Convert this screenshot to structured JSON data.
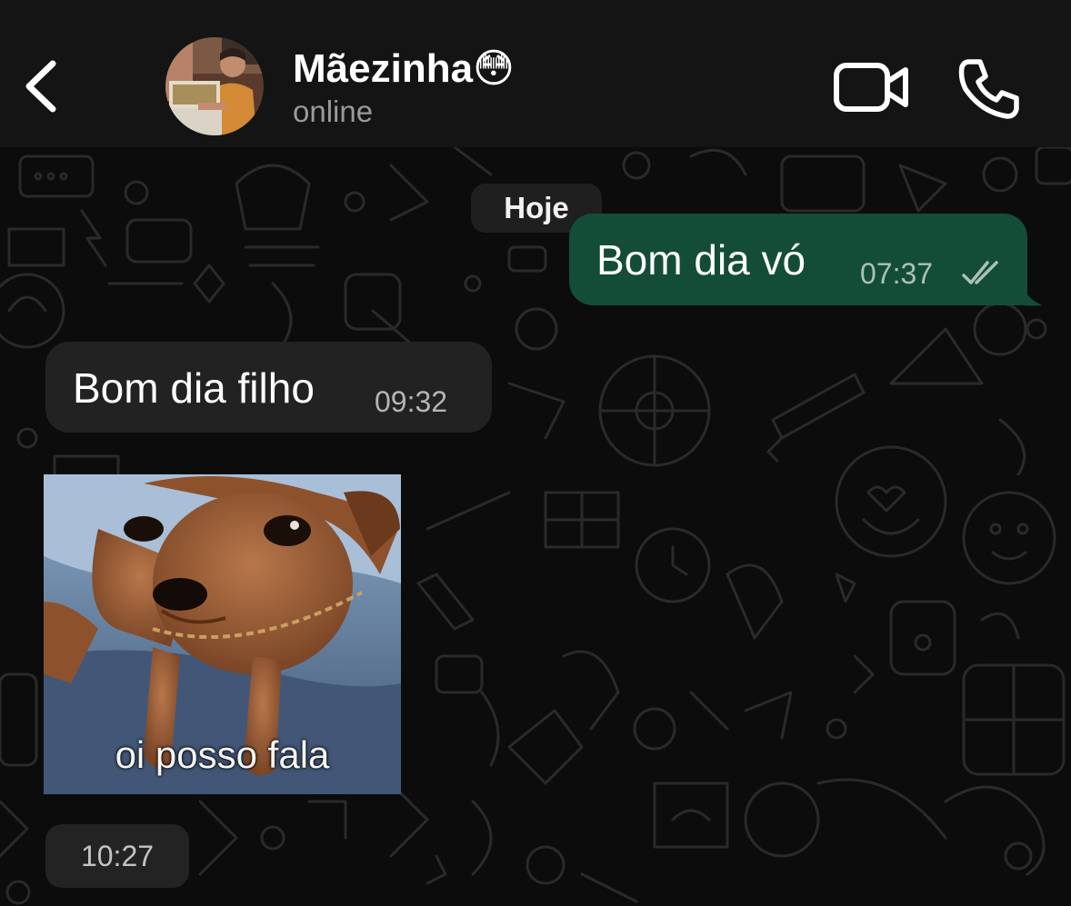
{
  "header": {
    "contact_name": "Mãezinha😳",
    "status": "online",
    "back_icon": "chevron-left-icon",
    "video_icon": "video-camera-icon",
    "call_icon": "phone-icon"
  },
  "chat": {
    "date_separator": "Hoje",
    "messages": [
      {
        "direction": "outgoing",
        "text": "Bom dia vó",
        "time": "07:37",
        "status": "read",
        "status_icon": "double-check-icon"
      },
      {
        "direction": "incoming",
        "text": "Bom dia filho",
        "time": "09:32"
      },
      {
        "direction": "incoming",
        "type": "sticker",
        "caption": "oi posso fala",
        "time": "10:27"
      }
    ]
  },
  "colors": {
    "header_bg": "#141414",
    "chat_bg": "#0c0c0c",
    "outgoing_bubble": "#144d37",
    "incoming_bubble": "#222222",
    "secondary_text": "#9a9a9a"
  }
}
